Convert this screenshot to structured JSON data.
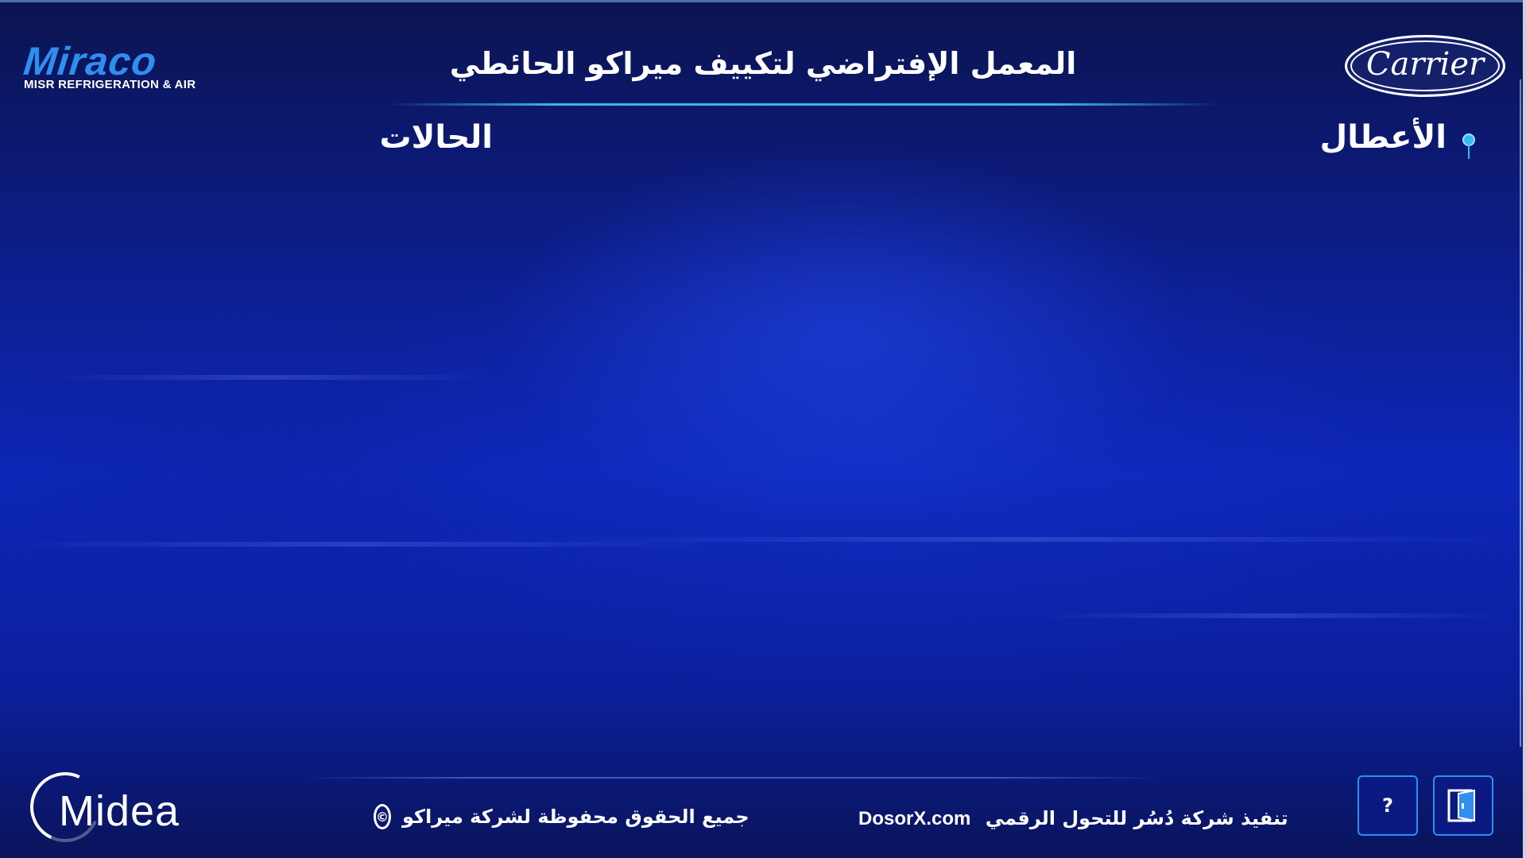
{
  "brand": {
    "left_logo_word": "Miraco",
    "left_logo_sub": "MISR REFRIGERATION & AIR",
    "right_logo_word": "Carrier",
    "footer_logo_word": "Midea"
  },
  "header": {
    "title": "المعمل الإفتراضي لتكييف ميراكو الحائطي"
  },
  "sections": {
    "faults": "الأعطال",
    "states": "الحالات"
  },
  "footer": {
    "copyright_text": "جميع الحقوق محفوظة لشركة ميراكو",
    "copyright_symbol": "©",
    "credit_arabic": "تنفيذ شركة دُسُر للتحول الرقمي",
    "credit_site": "DosorX.com"
  },
  "buttons": {
    "help_label": "?",
    "exit_icon": "exit-door-icon"
  },
  "colors": {
    "accent": "#39b8ef",
    "logo_blue": "#2f8ef0",
    "background_deep": "#0b1450"
  }
}
